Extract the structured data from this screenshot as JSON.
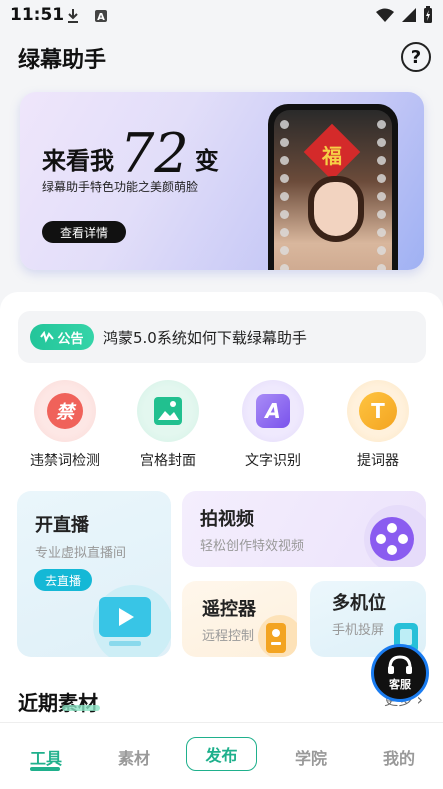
{
  "status_bar": {
    "time": "11:51",
    "left_icons": [
      "download-icon",
      "app-a-icon"
    ],
    "right_icons": [
      "wifi-icon",
      "signal-icon",
      "battery-charging-icon"
    ]
  },
  "header": {
    "title": "绿幕助手",
    "help_icon": "help-icon",
    "help_glyph": "?"
  },
  "banner": {
    "title_pre": "来看我",
    "title_num": "72",
    "title_post": "变",
    "subtitle": "绿幕助手特色功能之美颜萌脸",
    "button_label": "查看详情",
    "phone_screen_char": "福"
  },
  "notice": {
    "badge": "公告",
    "text": "鸿蒙5.0系统如何下载绿幕助手"
  },
  "tools": [
    {
      "label": "违禁词检测",
      "icon": "forbidden-word-icon",
      "glyph": "禁",
      "color": "#f0625a"
    },
    {
      "label": "宫格封面",
      "icon": "grid-cover-icon",
      "glyph": "▣",
      "color": "#21c08f"
    },
    {
      "label": "文字识别",
      "icon": "text-recognition-icon",
      "glyph": "A",
      "color": "#8a63f0"
    },
    {
      "label": "提词器",
      "icon": "teleprompter-icon",
      "glyph": "T",
      "color": "#f3a421"
    }
  ],
  "cards": {
    "live": {
      "title": "开直播",
      "subtitle": "专业虚拟直播间",
      "button": "去直播"
    },
    "video": {
      "title": "拍视频",
      "subtitle": "轻松创作特效视频"
    },
    "remote": {
      "title": "遥控器",
      "subtitle": "远程控制"
    },
    "multi": {
      "title": "多机位",
      "subtitle": "手机投屏"
    }
  },
  "recent": {
    "title": "近期素材",
    "more": "更多"
  },
  "customer_service": {
    "label": "客服"
  },
  "tabbar": {
    "items": [
      "工具",
      "素材",
      "发布",
      "学院",
      "我的"
    ],
    "active": "工具"
  }
}
